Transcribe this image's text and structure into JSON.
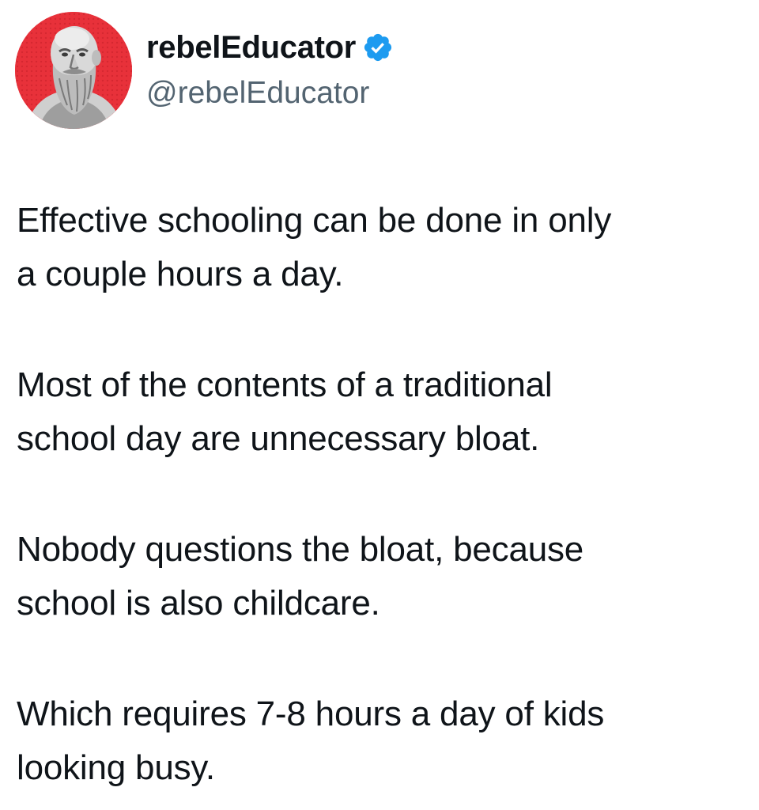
{
  "author": {
    "display_name": "rebelEducator",
    "handle": "@rebelEducator",
    "verified": true,
    "avatar_icon": "socrates-bust-avatar",
    "avatar_bg": "#e8313a",
    "badge_color": "#1d9bf0"
  },
  "tweet": {
    "paragraphs": [
      "Effective schooling can be done in only\na couple hours a day.",
      "Most of the contents of a traditional\nschool day are unnecessary bloat.",
      "Nobody questions the bloat, because\nschool is also childcare.",
      "Which requires 7-8 hours a day of kids\nlooking busy."
    ]
  }
}
